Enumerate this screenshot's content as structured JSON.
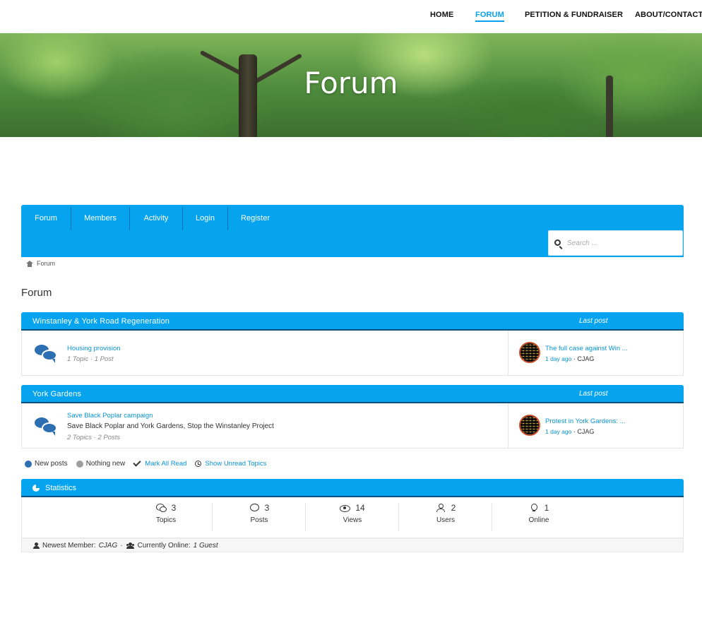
{
  "nav": {
    "items": [
      {
        "label": "HOME",
        "active": false
      },
      {
        "label": "FORUM",
        "active": true
      },
      {
        "label": "PETITION & FUNDRAISER",
        "active": false
      },
      {
        "label": "ABOUT/CONTACT",
        "active": false
      }
    ]
  },
  "hero": {
    "title": "Forum"
  },
  "forum_menu": {
    "items": [
      "Forum",
      "Members",
      "Activity",
      "Login",
      "Register"
    ],
    "search_placeholder": "Search ..."
  },
  "breadcrumb": {
    "label": "Forum"
  },
  "page_title": "Forum",
  "categories": [
    {
      "title": "Winstanley & York Road Regeneration",
      "last_post_header": "Last post",
      "forums": [
        {
          "name": "Housing provision",
          "description": "",
          "counts": "1 Topic · 1 Post",
          "last_post_title": "The full case against Win ...",
          "last_post_ago": "1 day ago",
          "last_post_sep": "·",
          "last_post_author": "CJAG"
        }
      ]
    },
    {
      "title": "York Gardens",
      "last_post_header": "Last post",
      "forums": [
        {
          "name": "Save Black Poplar campaign",
          "description": "Save Black Poplar and York Gardens, Stop the Winstanley Project",
          "counts": "2 Topics · 2 Posts",
          "last_post_title": "Protest in York Gardens: ...",
          "last_post_ago": "1 day ago",
          "last_post_sep": "·",
          "last_post_author": "CJAG"
        }
      ]
    }
  ],
  "legend": {
    "new_posts": "New posts",
    "nothing_new": "Nothing new",
    "mark_all_read": "Mark All Read",
    "show_unread": "Show Unread Topics"
  },
  "statistics": {
    "title": "Statistics",
    "items": [
      {
        "icon": "topics-icon",
        "value": "3",
        "label": "Topics"
      },
      {
        "icon": "posts-icon",
        "value": "3",
        "label": "Posts"
      },
      {
        "icon": "views-icon",
        "value": "14",
        "label": "Views"
      },
      {
        "icon": "users-icon",
        "value": "2",
        "label": "Users"
      },
      {
        "icon": "online-icon",
        "value": "1",
        "label": "Online"
      }
    ],
    "newest_member_label": "Newest Member:",
    "newest_member": "CJAG",
    "separator": "·",
    "currently_online_label": "Currently Online:",
    "currently_online": "1 Guest"
  },
  "colors": {
    "accent": "#06a4ee",
    "link": "#0a94d8",
    "new_dot": "#2d6fb3",
    "nothing_new_dot": "#9e9e9e"
  }
}
